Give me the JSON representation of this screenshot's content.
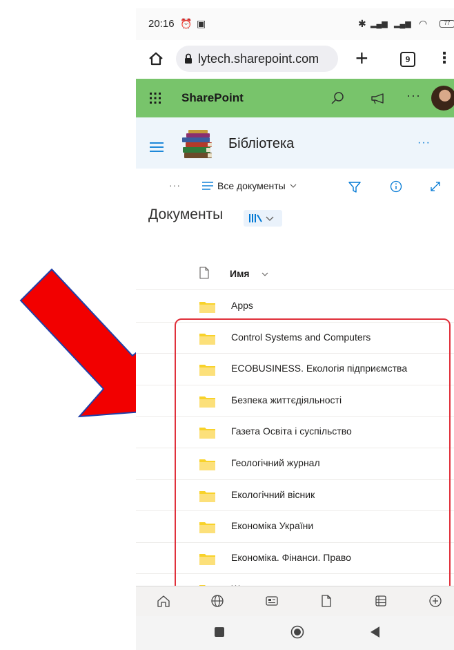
{
  "status_bar": {
    "time": "20:16",
    "battery": "77"
  },
  "browser": {
    "url": "lytech.sharepoint.com",
    "tab_count": "9"
  },
  "suite_bar": {
    "app_name": "SharePoint",
    "more": "···"
  },
  "site": {
    "title": "Бібліотека",
    "more": "···"
  },
  "command_bar": {
    "more": "···",
    "view_label": "Все документы"
  },
  "library": {
    "title": "Документы"
  },
  "list": {
    "name_column": "Имя",
    "items": [
      {
        "name": "Apps"
      },
      {
        "name": "Control Systems and Computers"
      },
      {
        "name": "ECOBUSINESS. Екологія підприємства"
      },
      {
        "name": "Безпека життєдіяльності"
      },
      {
        "name": "Газета Освіта і суспільство"
      },
      {
        "name": "Геологічний журнал"
      },
      {
        "name": "Екологічний вісник"
      },
      {
        "name": "Економіка України"
      },
      {
        "name": "Економіка. Фінанси. Право"
      },
      {
        "name": "Журнал головного енергетика"
      }
    ]
  },
  "colors": {
    "suite_bar": "#78c46b",
    "accent": "#0078d4",
    "folder": "#f8d22a",
    "highlight": "#e0303b",
    "arrow": "#f20000"
  }
}
